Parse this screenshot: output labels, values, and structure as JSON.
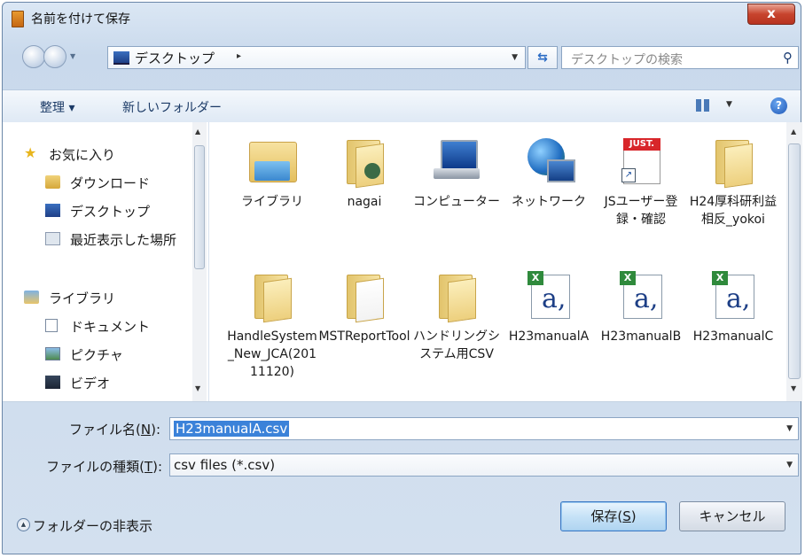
{
  "window": {
    "title": "名前を付けて保存",
    "close_glyph": "x"
  },
  "address": {
    "location": "デスクトップ",
    "separator": "▸"
  },
  "search": {
    "placeholder": "デスクトップの検索"
  },
  "toolbar": {
    "organize_label": "整理 ▾",
    "new_folder_label": "新しいフォルダー"
  },
  "nav": {
    "items": [
      {
        "label": "お気に入り",
        "icon": "star-icon"
      },
      {
        "label": "ダウンロード",
        "icon": "downloads-icon"
      },
      {
        "label": "デスクトップ",
        "icon": "desktop-icon"
      },
      {
        "label": "最近表示した場所",
        "icon": "recent-places-icon"
      },
      {
        "label": "ライブラリ",
        "icon": "library-icon"
      },
      {
        "label": "ドキュメント",
        "icon": "documents-icon"
      },
      {
        "label": "ピクチャ",
        "icon": "pictures-icon"
      },
      {
        "label": "ビデオ",
        "icon": "videos-icon"
      }
    ]
  },
  "files": [
    {
      "label": "ライブラリ",
      "icon": "libraries-folder-icon"
    },
    {
      "label": "nagai",
      "icon": "user-folder-icon"
    },
    {
      "label": "コンピューター",
      "icon": "computer-icon"
    },
    {
      "label": "ネットワーク",
      "icon": "network-icon"
    },
    {
      "label": "JSユーザー登録・確認",
      "icon": "just-shortcut-icon",
      "badge": "JUST."
    },
    {
      "label": "H24厚科研利益相反_yokoi",
      "icon": "folder-icon"
    },
    {
      "label": "HandleSystem_New_JCA(20111120)",
      "icon": "folder-icon"
    },
    {
      "label": "MSTReportTool",
      "icon": "folder-icon"
    },
    {
      "label": "ハンドリングシステム用CSV",
      "icon": "folder-icon"
    },
    {
      "label": "H23manualA",
      "icon": "csv-excel-icon",
      "glyph": "a,"
    },
    {
      "label": "H23manualB",
      "icon": "csv-excel-icon",
      "glyph": "a,"
    },
    {
      "label": "H23manualC",
      "icon": "csv-excel-icon",
      "glyph": "a,"
    }
  ],
  "form": {
    "filename_label_pre": "ファイル名(",
    "filename_key": "N",
    "filename_label_post": "):",
    "filename_value": "H23manualA.csv",
    "filetype_label_pre": "ファイルの種類(",
    "filetype_key": "T",
    "filetype_label_post": "):",
    "filetype_value": "csv files (*.csv)"
  },
  "footer": {
    "hide_folders_label": "フォルダーの非表示",
    "save_label_pre": "保存(",
    "save_key": "S",
    "save_label_post": ")",
    "cancel_label": "キャンセル"
  },
  "colors": {
    "accent": "#3b82d9",
    "title_bg": "#c9d9ec",
    "close": "#c7442d"
  }
}
